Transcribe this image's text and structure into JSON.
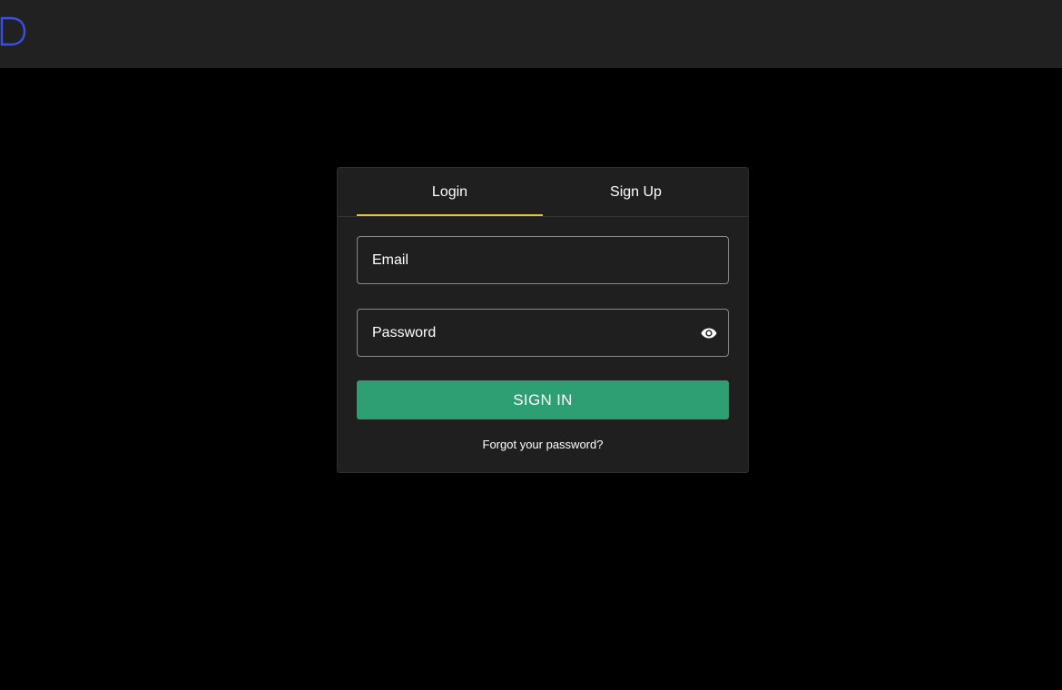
{
  "header": {
    "logo_text": "D",
    "logo_color": "#3a4ef0",
    "background": "#212121"
  },
  "auth": {
    "tabs": [
      {
        "label": "Login",
        "active": true
      },
      {
        "label": "Sign Up",
        "active": false
      }
    ],
    "indicator_color": "#e8c22f",
    "email": {
      "placeholder": "Email",
      "value": ""
    },
    "password": {
      "placeholder": "Password",
      "value": "",
      "toggle_icon": "eye-icon"
    },
    "submit_label": "SIGN IN",
    "submit_color": "#2e9e73",
    "forgot_label": "Forgot your password?"
  }
}
